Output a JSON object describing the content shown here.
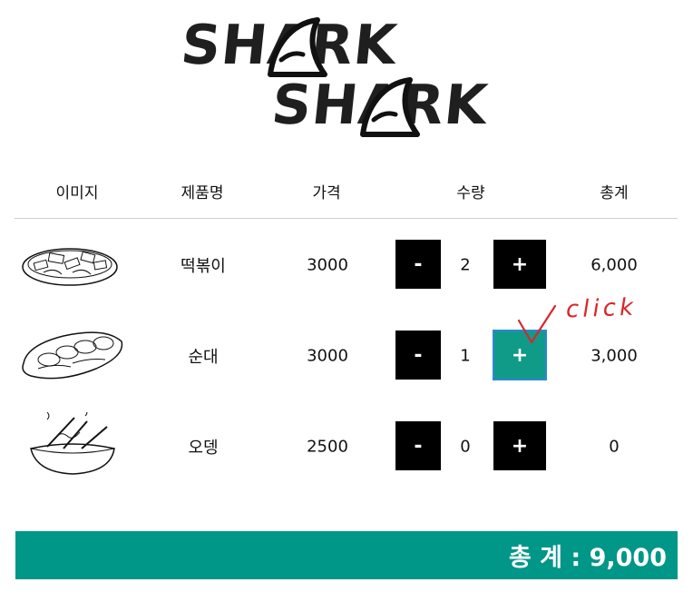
{
  "brand": {
    "line1": "SHARK",
    "line2": "SHARK"
  },
  "table": {
    "headers": [
      "이미지",
      "제품명",
      "가격",
      "수량",
      "총계"
    ],
    "rows": [
      {
        "image": "tteokbokki-illustration",
        "name": "떡볶이",
        "price": "3000",
        "quantity": "2",
        "total": "6,000",
        "minus": "-",
        "plus": "+"
      },
      {
        "image": "sundae-illustration",
        "name": "순대",
        "price": "3000",
        "quantity": "1",
        "total": "3,000",
        "minus": "-",
        "plus": "+"
      },
      {
        "image": "odeng-illustration",
        "name": "오뎅",
        "price": "2500",
        "quantity": "0",
        "total": "0",
        "minus": "-",
        "plus": "+"
      }
    ]
  },
  "footer": {
    "total_label": "총 계 : 9,000"
  },
  "annotation": {
    "text": "click"
  },
  "colors": {
    "accent": "#009688",
    "active_button": "#0f9b88",
    "button": "#000000",
    "annotation": "#d9262a"
  }
}
